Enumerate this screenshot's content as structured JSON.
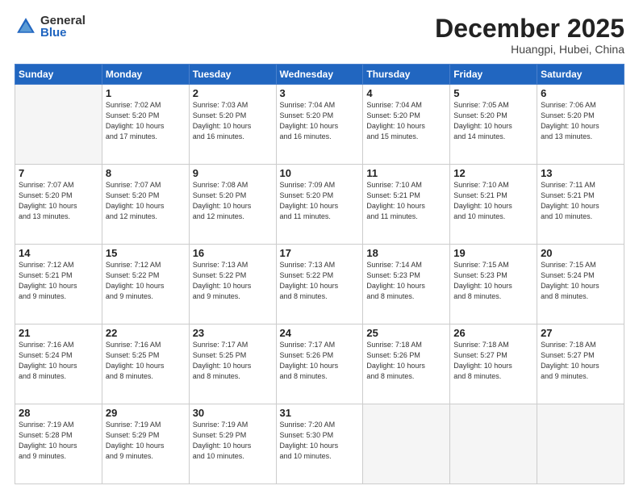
{
  "logo": {
    "general": "General",
    "blue": "Blue"
  },
  "header": {
    "month": "December 2025",
    "location": "Huangpi, Hubei, China"
  },
  "weekdays": [
    "Sunday",
    "Monday",
    "Tuesday",
    "Wednesday",
    "Thursday",
    "Friday",
    "Saturday"
  ],
  "weeks": [
    [
      {
        "day": null,
        "info": null
      },
      {
        "day": "1",
        "info": "Sunrise: 7:02 AM\nSunset: 5:20 PM\nDaylight: 10 hours\nand 17 minutes."
      },
      {
        "day": "2",
        "info": "Sunrise: 7:03 AM\nSunset: 5:20 PM\nDaylight: 10 hours\nand 16 minutes."
      },
      {
        "day": "3",
        "info": "Sunrise: 7:04 AM\nSunset: 5:20 PM\nDaylight: 10 hours\nand 16 minutes."
      },
      {
        "day": "4",
        "info": "Sunrise: 7:04 AM\nSunset: 5:20 PM\nDaylight: 10 hours\nand 15 minutes."
      },
      {
        "day": "5",
        "info": "Sunrise: 7:05 AM\nSunset: 5:20 PM\nDaylight: 10 hours\nand 14 minutes."
      },
      {
        "day": "6",
        "info": "Sunrise: 7:06 AM\nSunset: 5:20 PM\nDaylight: 10 hours\nand 13 minutes."
      }
    ],
    [
      {
        "day": "7",
        "info": "Sunrise: 7:07 AM\nSunset: 5:20 PM\nDaylight: 10 hours\nand 13 minutes."
      },
      {
        "day": "8",
        "info": "Sunrise: 7:07 AM\nSunset: 5:20 PM\nDaylight: 10 hours\nand 12 minutes."
      },
      {
        "day": "9",
        "info": "Sunrise: 7:08 AM\nSunset: 5:20 PM\nDaylight: 10 hours\nand 12 minutes."
      },
      {
        "day": "10",
        "info": "Sunrise: 7:09 AM\nSunset: 5:20 PM\nDaylight: 10 hours\nand 11 minutes."
      },
      {
        "day": "11",
        "info": "Sunrise: 7:10 AM\nSunset: 5:21 PM\nDaylight: 10 hours\nand 11 minutes."
      },
      {
        "day": "12",
        "info": "Sunrise: 7:10 AM\nSunset: 5:21 PM\nDaylight: 10 hours\nand 10 minutes."
      },
      {
        "day": "13",
        "info": "Sunrise: 7:11 AM\nSunset: 5:21 PM\nDaylight: 10 hours\nand 10 minutes."
      }
    ],
    [
      {
        "day": "14",
        "info": "Sunrise: 7:12 AM\nSunset: 5:21 PM\nDaylight: 10 hours\nand 9 minutes."
      },
      {
        "day": "15",
        "info": "Sunrise: 7:12 AM\nSunset: 5:22 PM\nDaylight: 10 hours\nand 9 minutes."
      },
      {
        "day": "16",
        "info": "Sunrise: 7:13 AM\nSunset: 5:22 PM\nDaylight: 10 hours\nand 9 minutes."
      },
      {
        "day": "17",
        "info": "Sunrise: 7:13 AM\nSunset: 5:22 PM\nDaylight: 10 hours\nand 8 minutes."
      },
      {
        "day": "18",
        "info": "Sunrise: 7:14 AM\nSunset: 5:23 PM\nDaylight: 10 hours\nand 8 minutes."
      },
      {
        "day": "19",
        "info": "Sunrise: 7:15 AM\nSunset: 5:23 PM\nDaylight: 10 hours\nand 8 minutes."
      },
      {
        "day": "20",
        "info": "Sunrise: 7:15 AM\nSunset: 5:24 PM\nDaylight: 10 hours\nand 8 minutes."
      }
    ],
    [
      {
        "day": "21",
        "info": "Sunrise: 7:16 AM\nSunset: 5:24 PM\nDaylight: 10 hours\nand 8 minutes."
      },
      {
        "day": "22",
        "info": "Sunrise: 7:16 AM\nSunset: 5:25 PM\nDaylight: 10 hours\nand 8 minutes."
      },
      {
        "day": "23",
        "info": "Sunrise: 7:17 AM\nSunset: 5:25 PM\nDaylight: 10 hours\nand 8 minutes."
      },
      {
        "day": "24",
        "info": "Sunrise: 7:17 AM\nSunset: 5:26 PM\nDaylight: 10 hours\nand 8 minutes."
      },
      {
        "day": "25",
        "info": "Sunrise: 7:18 AM\nSunset: 5:26 PM\nDaylight: 10 hours\nand 8 minutes."
      },
      {
        "day": "26",
        "info": "Sunrise: 7:18 AM\nSunset: 5:27 PM\nDaylight: 10 hours\nand 8 minutes."
      },
      {
        "day": "27",
        "info": "Sunrise: 7:18 AM\nSunset: 5:27 PM\nDaylight: 10 hours\nand 9 minutes."
      }
    ],
    [
      {
        "day": "28",
        "info": "Sunrise: 7:19 AM\nSunset: 5:28 PM\nDaylight: 10 hours\nand 9 minutes."
      },
      {
        "day": "29",
        "info": "Sunrise: 7:19 AM\nSunset: 5:29 PM\nDaylight: 10 hours\nand 9 minutes."
      },
      {
        "day": "30",
        "info": "Sunrise: 7:19 AM\nSunset: 5:29 PM\nDaylight: 10 hours\nand 10 minutes."
      },
      {
        "day": "31",
        "info": "Sunrise: 7:20 AM\nSunset: 5:30 PM\nDaylight: 10 hours\nand 10 minutes."
      },
      {
        "day": null,
        "info": null
      },
      {
        "day": null,
        "info": null
      },
      {
        "day": null,
        "info": null
      }
    ]
  ]
}
